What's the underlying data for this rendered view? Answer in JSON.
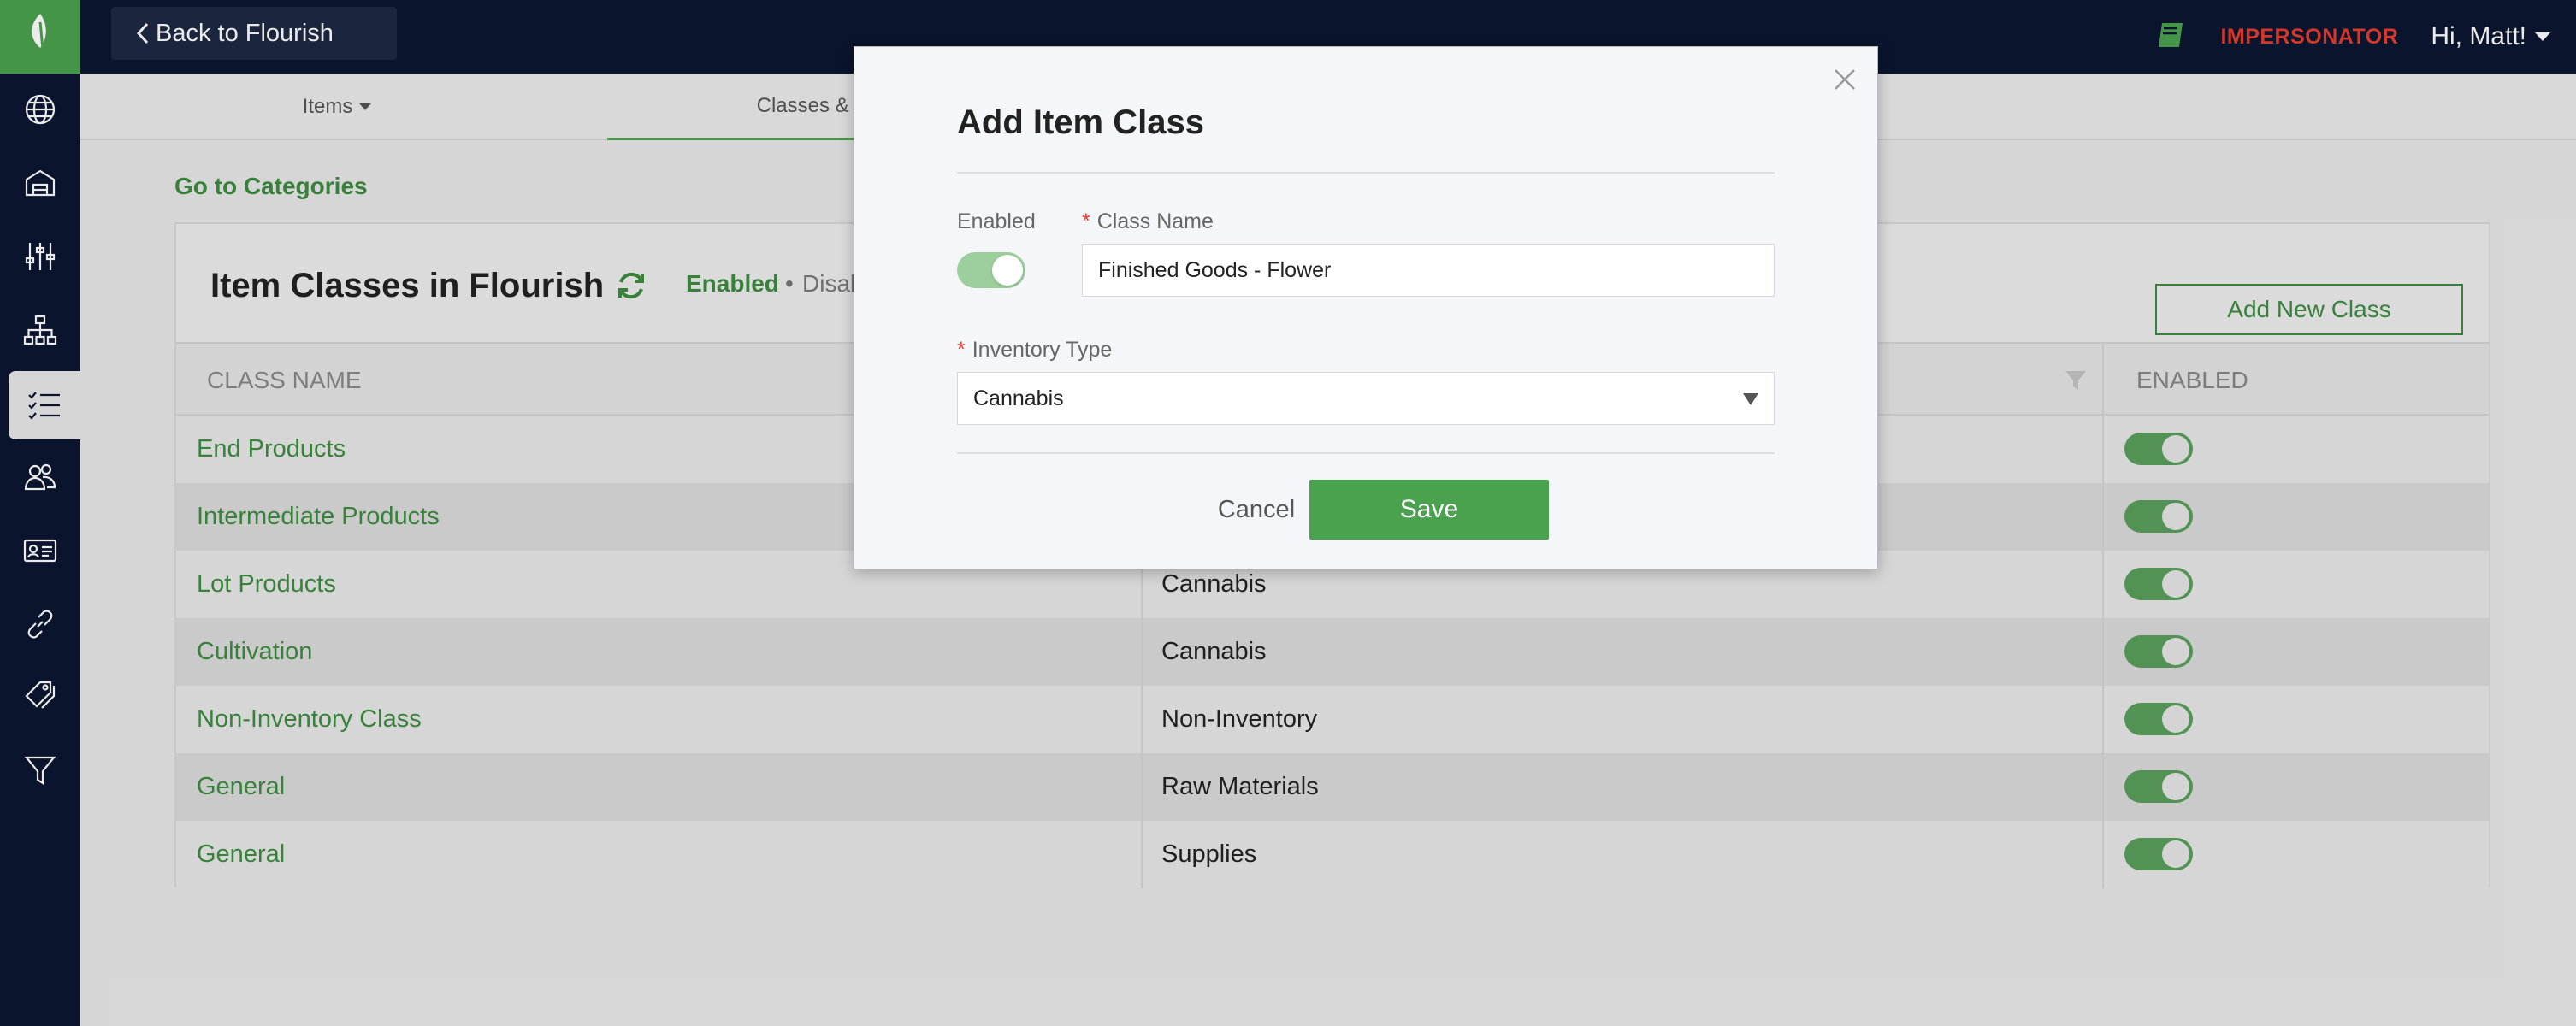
{
  "topbar": {
    "back_label": "Back to Flourish",
    "impersonator_label": "IMPERSONATOR",
    "greeting": "Hi, Matt!"
  },
  "subnav": {
    "items_label": "Items",
    "classes_label": "Classes & Categories"
  },
  "page": {
    "goto_link": "Go to Categories",
    "title": "Item Classes in Flourish",
    "filter_enabled": "Enabled",
    "filter_separator": "•",
    "filter_disabled": "Disabled",
    "add_class_label": "Add New Class"
  },
  "table": {
    "headers": {
      "class_name": "CLASS NAME",
      "enabled": "ENABLED"
    },
    "rows": [
      {
        "name": "End Products",
        "type": "",
        "enabled": true
      },
      {
        "name": "Intermediate Products",
        "type": "",
        "enabled": true
      },
      {
        "name": "Lot Products",
        "type": "Cannabis",
        "enabled": true
      },
      {
        "name": "Cultivation",
        "type": "Cannabis",
        "enabled": true
      },
      {
        "name": "Non-Inventory Class",
        "type": "Non-Inventory",
        "enabled": true
      },
      {
        "name": "General",
        "type": "Raw Materials",
        "enabled": true
      },
      {
        "name": "General",
        "type": "Supplies",
        "enabled": true
      }
    ]
  },
  "modal": {
    "title": "Add Item Class",
    "enabled_label": "Enabled",
    "required_marker": "*",
    "class_name_label": "Class Name",
    "class_name_value": "Finished Goods - Flower",
    "inventory_type_label": "Inventory Type",
    "inventory_type_value": "Cannabis",
    "enabled_value": true,
    "cancel_label": "Cancel",
    "save_label": "Save"
  },
  "colors": {
    "brand_green": "#4aa24f",
    "link_green": "#3d8d41",
    "sidebar_navy": "#0b1630",
    "alert_red": "#e63b2e"
  },
  "icons": {
    "sidebar": [
      "globe-icon",
      "warehouse-icon",
      "sliders-icon",
      "hierarchy-icon",
      "checklist-icon",
      "users-icon",
      "id-card-icon",
      "link-icon",
      "tags-icon",
      "filter-icon"
    ]
  }
}
